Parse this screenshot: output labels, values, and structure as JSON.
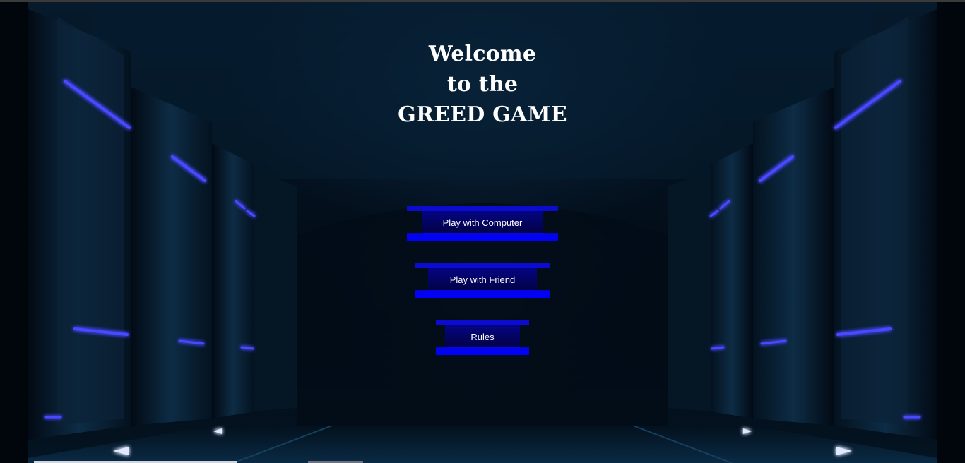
{
  "title": {
    "line1": "Welcome",
    "line2": "to the",
    "line3": "GREED GAME"
  },
  "menu": {
    "play_computer_label": "Play with Computer",
    "play_friend_label": "Play with Friend",
    "rules_label": "Rules"
  },
  "colors": {
    "button_blue": "#0000e6",
    "neon_light": "#3b3bff",
    "title_text": "#ffffff"
  }
}
